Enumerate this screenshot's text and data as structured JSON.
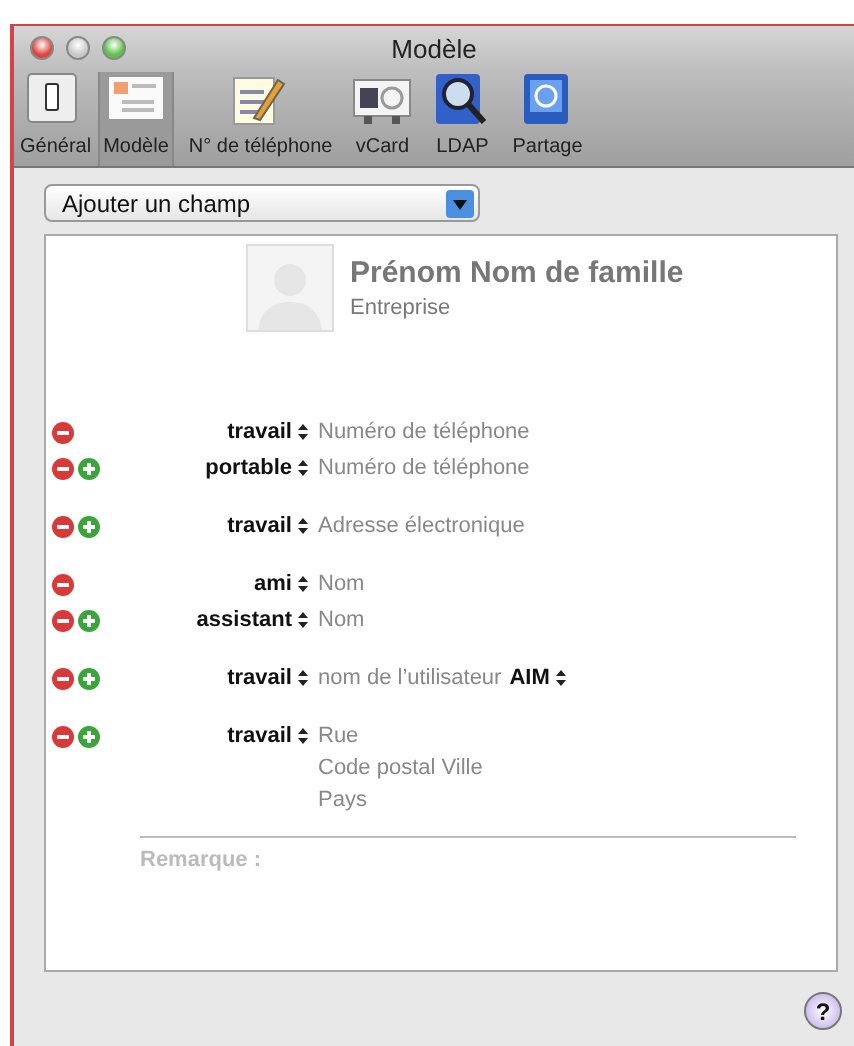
{
  "window": {
    "title": "Modèle"
  },
  "toolbar": [
    {
      "label": "Général",
      "kind": "switch",
      "selected": false
    },
    {
      "label": "Modèle",
      "kind": "template",
      "selected": true
    },
    {
      "label": "N° de téléphone",
      "kind": "notepad",
      "selected": false
    },
    {
      "label": "vCard",
      "kind": "vcard",
      "selected": false
    },
    {
      "label": "LDAP",
      "kind": "ldap",
      "selected": false
    },
    {
      "label": "Partage",
      "kind": "sharing",
      "selected": false
    }
  ],
  "add_field_popup": {
    "label": "Ajouter un champ"
  },
  "card": {
    "name": "Prénom Nom de famille",
    "company": "Entreprise",
    "groups": [
      [
        {
          "label": "travail",
          "lines": [
            "Numéro de téléphone"
          ],
          "can_add": false
        },
        {
          "label": "portable",
          "lines": [
            "Numéro de téléphone"
          ],
          "can_add": true
        }
      ],
      [
        {
          "label": "travail",
          "lines": [
            "Adresse électronique"
          ],
          "can_add": true
        }
      ],
      [
        {
          "label": "ami",
          "lines": [
            "Nom"
          ],
          "can_add": false
        },
        {
          "label": "assistant",
          "lines": [
            "Nom"
          ],
          "can_add": true
        }
      ],
      [
        {
          "label": "travail",
          "lines": [
            "nom de l’utilisateur"
          ],
          "service": "AIM",
          "can_add": true
        }
      ],
      [
        {
          "label": "travail",
          "lines": [
            "Rue",
            "Code postal Ville",
            "Pays"
          ],
          "can_add": true
        }
      ]
    ],
    "note_label": "Remarque :"
  },
  "help_button": "?"
}
